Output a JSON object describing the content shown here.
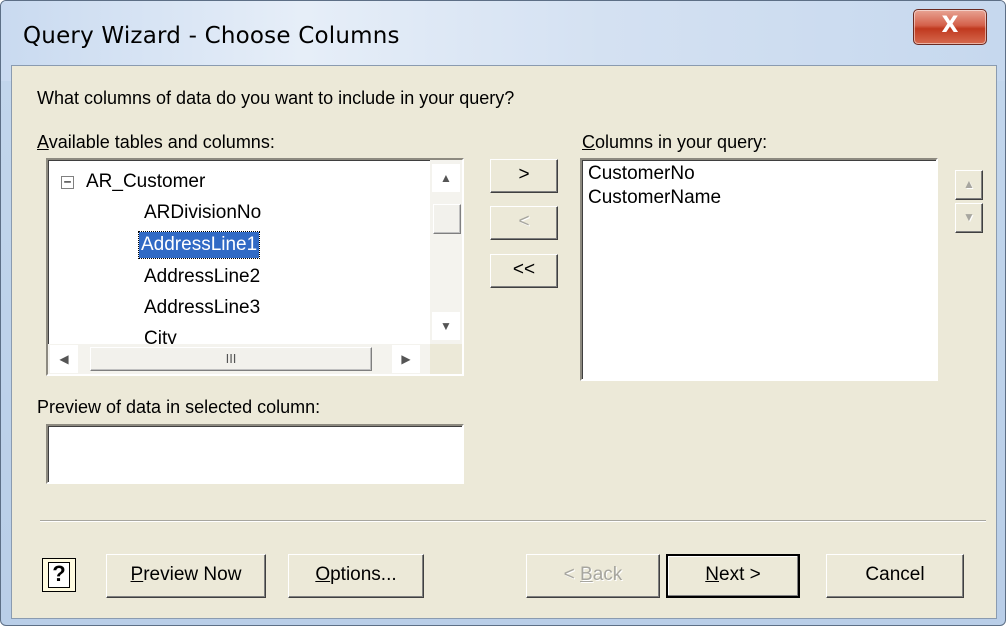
{
  "window": {
    "title": "Query Wizard - Choose Columns",
    "close_label": "X"
  },
  "prompt": "What columns of data do you want to include in your query?",
  "available": {
    "label_first": "A",
    "label_rest": "vailable tables and columns:",
    "expander": "−",
    "items": [
      {
        "label": "AR_Customer"
      },
      {
        "label": "ARDivisionNo"
      },
      {
        "label": "AddressLine1",
        "selected": true
      },
      {
        "label": "AddressLine2"
      },
      {
        "label": "AddressLine3"
      },
      {
        "label": "City"
      }
    ],
    "hscroll_grip": "III"
  },
  "move_buttons": {
    "add": ">",
    "remove": "<",
    "remove_all": "<<"
  },
  "query_columns": {
    "label_first": "C",
    "label_rest": "olumns in your query:",
    "items": [
      "CustomerNo",
      "CustomerName"
    ]
  },
  "preview": {
    "label": "Preview of data in selected column:",
    "value": ""
  },
  "footer": {
    "help_label": "?",
    "preview_now_first": "P",
    "preview_now_rest": "review Now",
    "options_first": "O",
    "options_rest": "ptions...",
    "back_prefix": "< ",
    "back_first": "B",
    "back_rest": "ack",
    "next_first": "N",
    "next_rest": "ext >",
    "cancel": "Cancel"
  }
}
